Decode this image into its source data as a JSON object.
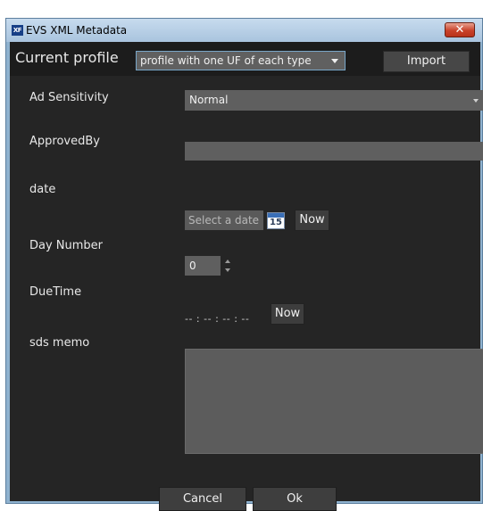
{
  "window": {
    "title": "EVS XML Metadata",
    "app_icon_text": "XF",
    "close_icon": "close-icon",
    "close_glyph": "✕"
  },
  "profile": {
    "label": "Current profile",
    "selected": "profile with one UF of each type",
    "import_label": "Import"
  },
  "fields": {
    "ad_sensitivity": {
      "label": "Ad Sensitivity",
      "value": "Normal"
    },
    "approved_by": {
      "label": "ApprovedBy",
      "value": ""
    },
    "date": {
      "label": "date",
      "placeholder": "Select a date",
      "calendar_day": "15",
      "now_label": "Now"
    },
    "day_number": {
      "label": "Day Number",
      "value": "0"
    },
    "due_time": {
      "label": "DueTime",
      "value": "-- : -- : -- : --",
      "now_label": "Now"
    },
    "sds_memo": {
      "label": "sds memo",
      "value": ""
    }
  },
  "buttons": {
    "cancel": "Cancel",
    "ok": "Ok"
  },
  "colors": {
    "background": "#252525",
    "input": "#5f5f5f",
    "accent_border": "#78a6c8",
    "close": "#c9422a"
  }
}
